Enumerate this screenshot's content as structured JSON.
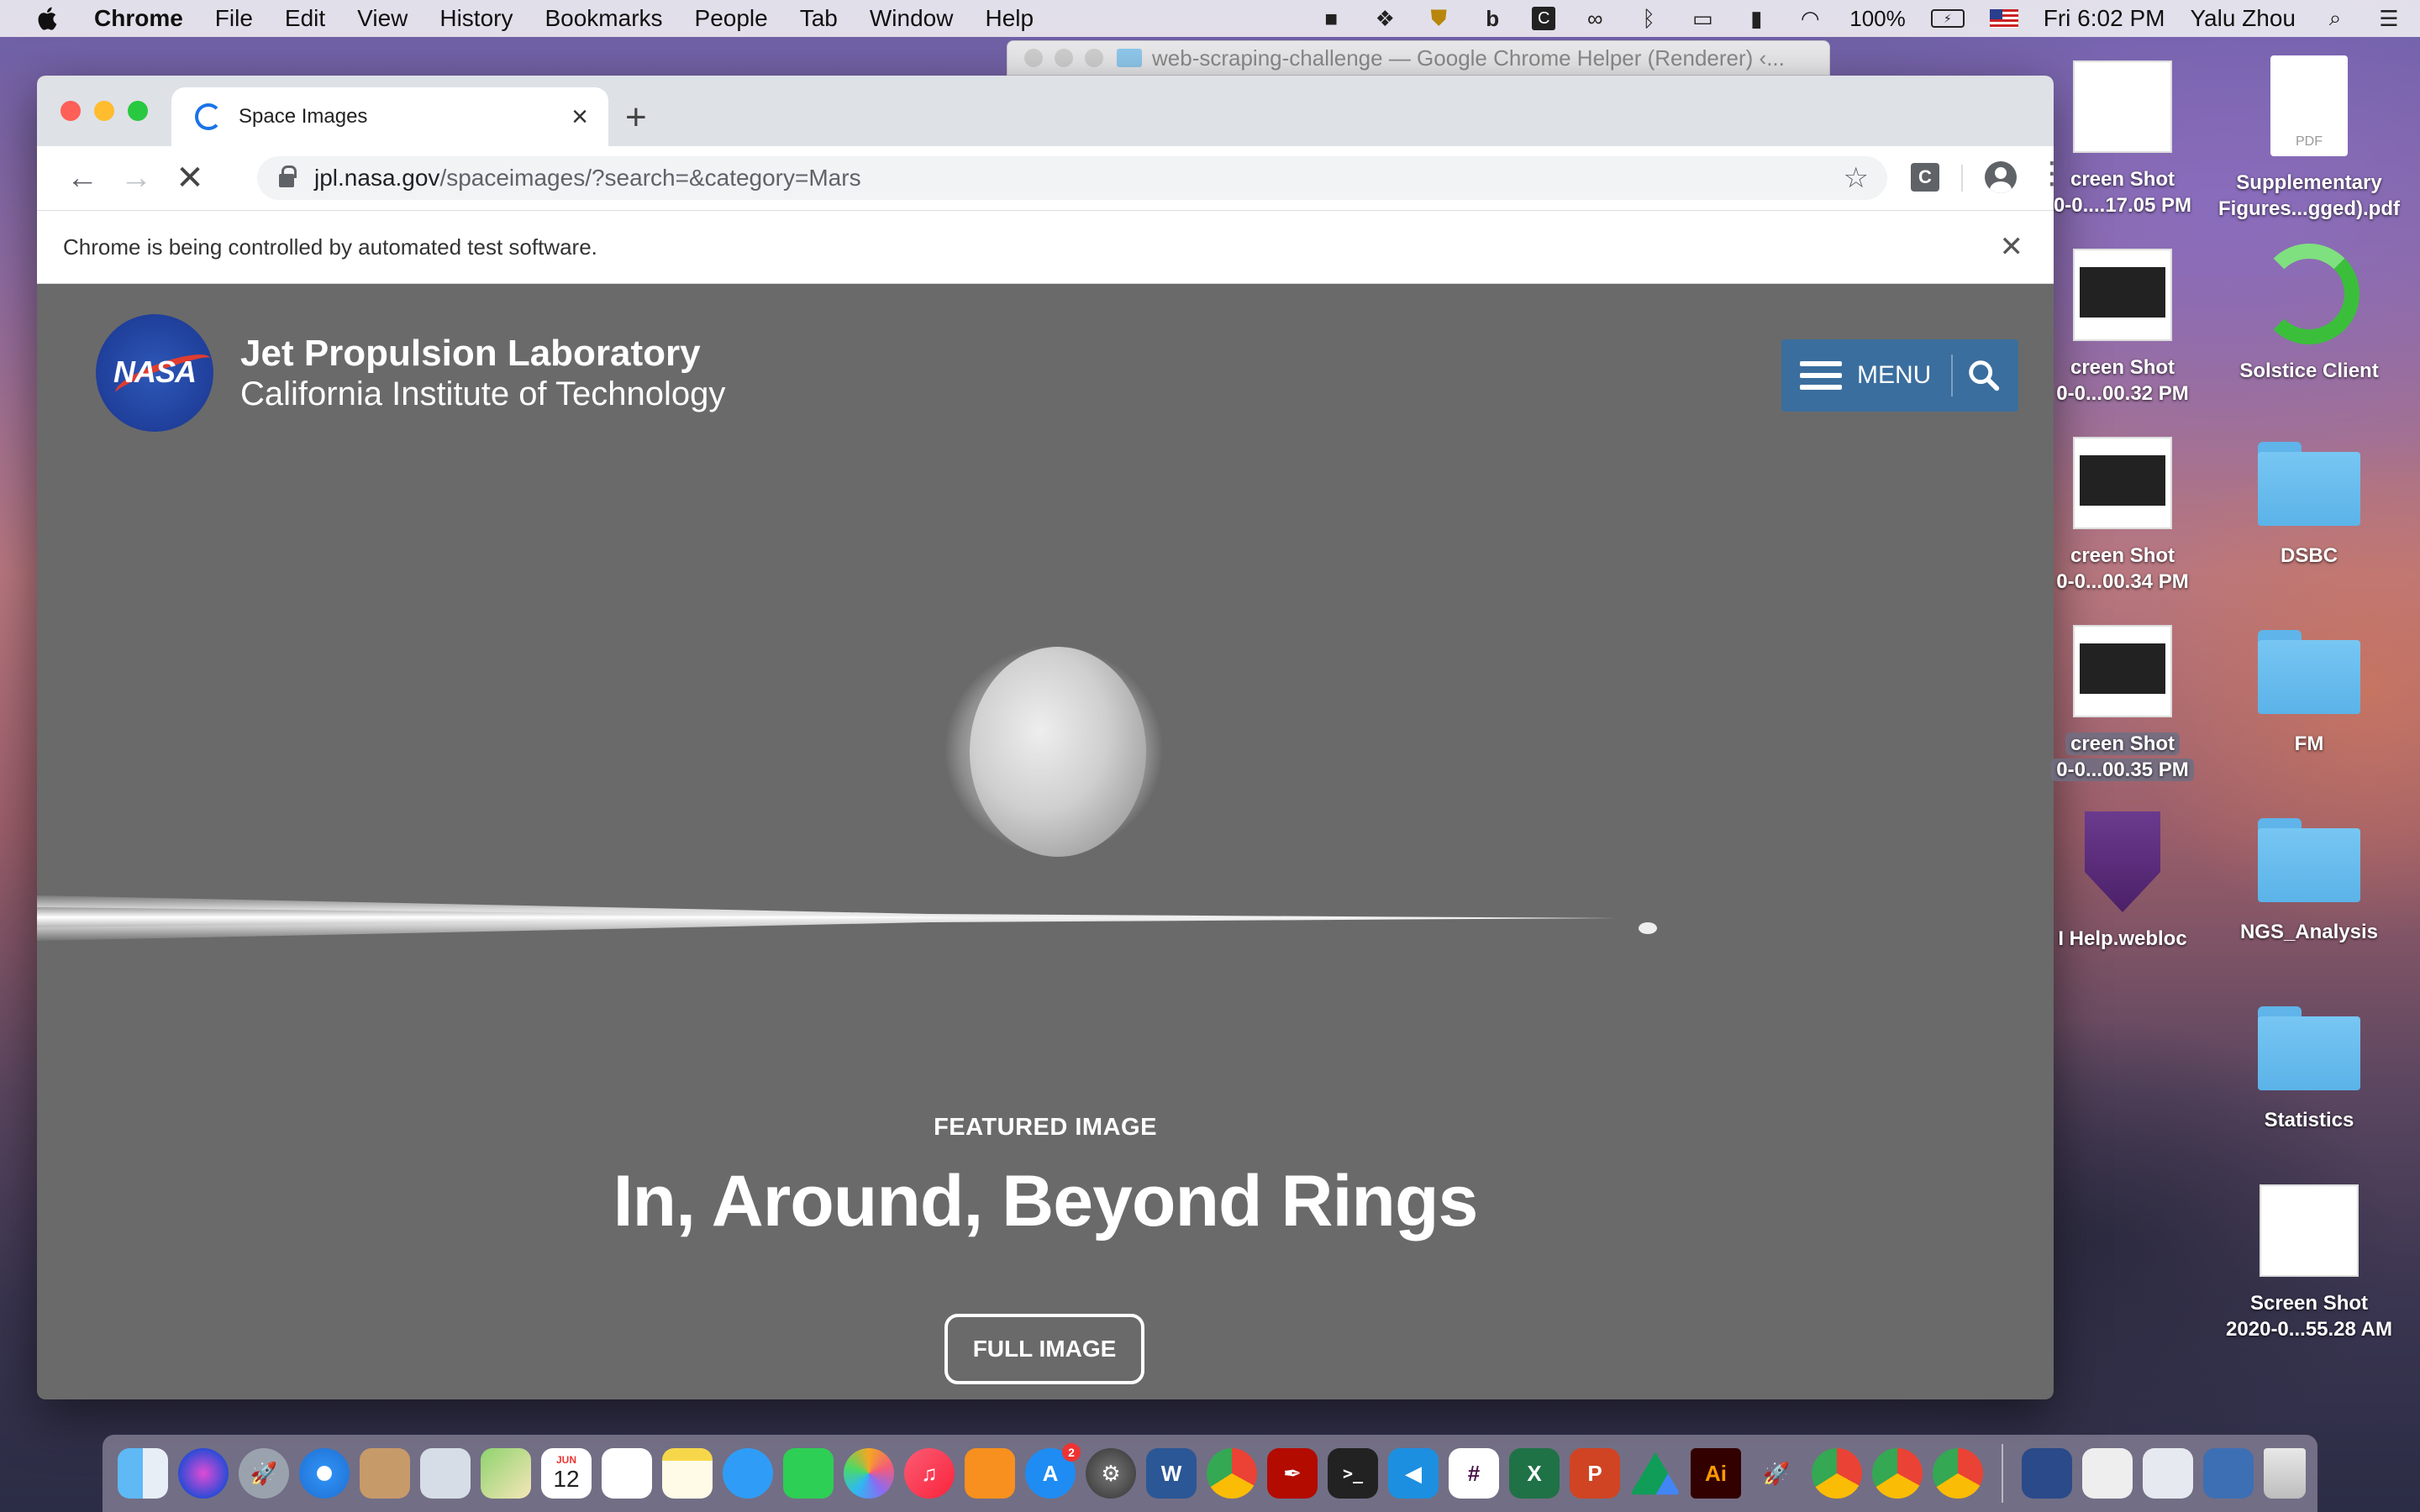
{
  "menubar": {
    "app_name": "Chrome",
    "items": [
      "File",
      "Edit",
      "View",
      "History",
      "Bookmarks",
      "People",
      "Tab",
      "Window",
      "Help"
    ],
    "battery": "100%",
    "clock": "Fri 6:02 PM",
    "user": "Yalu Zhou"
  },
  "helper_window": {
    "title": "web-scraping-challenge — Google Chrome Helper (Renderer) ‹..."
  },
  "browser": {
    "tab_title": "Space Images",
    "url_host": "jpl.nasa.gov",
    "url_path": "/spaceimages/?search=&category=Mars",
    "extension_label": "C",
    "infobar_text": "Chrome is being controlled by automated test software."
  },
  "page": {
    "nasa_logo_text": "NASA",
    "site_title": "Jet Propulsion Laboratory",
    "site_subtitle": "California Institute of Technology",
    "menu_label": "MENU",
    "featured_label": "FEATURED IMAGE",
    "featured_title": "In, Around, Beyond Rings",
    "full_image_label": "FULL IMAGE"
  },
  "desktop": {
    "items": [
      {
        "line1": "creen Shot",
        "line2": "0-0....17.05 PM"
      },
      {
        "line1": "Supplementary",
        "line2": "Figures...gged).pdf",
        "pdf_label": "PDF"
      },
      {
        "line1": "creen Shot",
        "line2": "0-0...00.32 PM"
      },
      {
        "line1": "Solstice Client",
        "line2": ""
      },
      {
        "line1": "creen Shot",
        "line2": "0-0...00.34 PM"
      },
      {
        "line1": "DSBC",
        "line2": ""
      },
      {
        "line1": "creen Shot",
        "line2": "0-0...00.35 PM"
      },
      {
        "line1": "FM",
        "line2": ""
      },
      {
        "line1": "I Help.webloc",
        "line2": ""
      },
      {
        "line1": "NGS_Analysis",
        "line2": ""
      },
      {
        "line1": "Statistics",
        "line2": ""
      },
      {
        "line1": "Screen Shot",
        "line2": "2020-0...55.28 AM"
      }
    ]
  },
  "dock": {
    "calendar_month": "JUN",
    "calendar_day": "12",
    "app_store_badge": "2",
    "word_letter": "W",
    "excel_letter": "X",
    "ppt_letter": "P",
    "illustrator_label": "Ai"
  }
}
